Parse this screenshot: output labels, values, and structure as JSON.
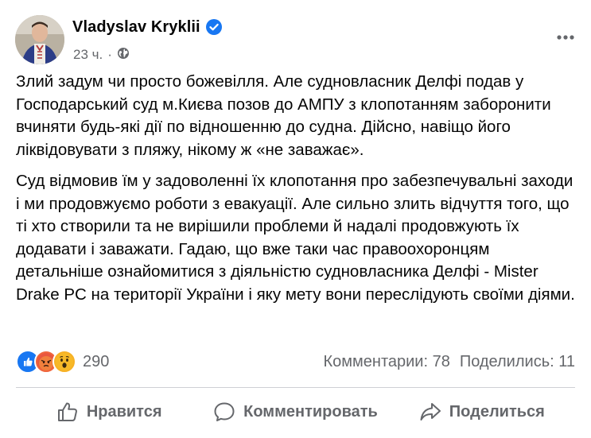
{
  "post": {
    "author": {
      "name": "Vladyslav Kryklii"
    },
    "timestamp": "23 ч.",
    "separator": "·",
    "visibility_icon": "globe-icon",
    "more_icon": "more-horizontal-icon",
    "paragraphs": [
      "Злий задум чи просто божевілля. Але судновласник Делфі подав у Господарський суд м.Києва позов до АМПУ з клопотанням заборонити вчиняти будь-які дії по відношенню до судна. Дійсно, навіщо його ліквідовувати з пляжу, нікому ж «не заважає».",
      "Суд відмовив їм у задоволенні їх клопотання про забезпечувальні заходи і ми продовжуємо роботи з евакуації. Але сильно злить відчуття того, що ті хто створили та не вирішили проблеми й надалі продовжують їх додавати і заважати. Гадаю, що вже таки час правоохоронцям детальніше ознайомитися з діяльністю судновласника Делфі - Mister Drake PC на території України і яку мету вони переслідують своїми діями."
    ]
  },
  "summary": {
    "reactions": [
      "like-reaction-icon",
      "angry-reaction-icon",
      "wow-reaction-icon"
    ],
    "reaction_count": "290",
    "comments": "Комментарии: 78",
    "shares": "Поделились: 11"
  },
  "actions": {
    "like_label": "Нравится",
    "comment_label": "Комментировать",
    "share_label": "Поделиться"
  },
  "colors": {
    "text_primary": "#050505",
    "text_secondary": "#65676b",
    "verified_blue": "#1877f2",
    "divider": "#ced0d4"
  }
}
